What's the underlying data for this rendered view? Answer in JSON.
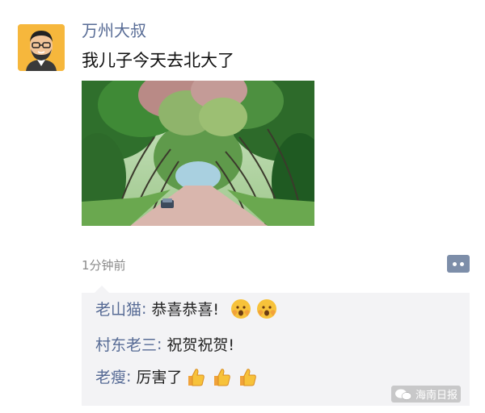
{
  "post": {
    "author": "万州大叔",
    "text": "我儿子今天去北大了",
    "time": "1分钟前"
  },
  "comments": [
    {
      "name": "老山猫",
      "text": "恭喜恭喜!",
      "emoji": [
        "surprised-face-icon",
        "surprised-face-icon"
      ]
    },
    {
      "name": "村东老三",
      "text": "祝贺祝贺!",
      "emoji": []
    },
    {
      "name": "老瘦",
      "text": "厉害了",
      "emoji": [
        "thumbs-up-icon",
        "thumbs-up-icon",
        "thumbs-up-icon"
      ]
    }
  ],
  "separator": ":",
  "watermark": "海南日报",
  "colors": {
    "name_link": "#576b95",
    "comment_bg": "#f3f3f5",
    "avatar_bg": "#f6b73c"
  }
}
